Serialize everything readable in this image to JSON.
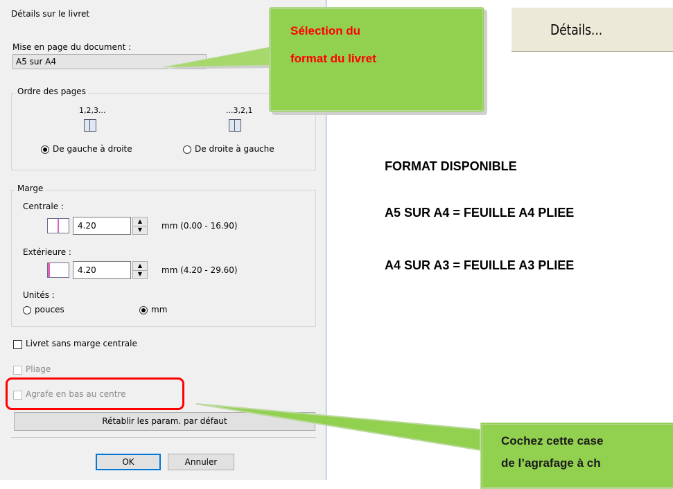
{
  "dialog": {
    "title": "Détails sur le livret",
    "layout_label": "Mise en page du document :",
    "layout_value": "A5 sur A4",
    "page_order": {
      "legend": "Ordre des pages",
      "ltr_icon_label": "1,2,3...",
      "rtl_icon_label": "...3,2,1",
      "ltr_label": "De gauche à droite",
      "rtl_label": "De droite à gauche",
      "selected": "ltr"
    },
    "margin": {
      "legend": "Marge",
      "central_label": "Centrale :",
      "central_value": "4.20",
      "central_range": "mm (0.00 - 16.90)",
      "outer_label": "Extérieure :",
      "outer_value": "4.20",
      "outer_range": "mm (4.20 - 29.60)",
      "units_label": "Unités :",
      "unit_inches": "pouces",
      "unit_mm": "mm",
      "selected_unit": "mm"
    },
    "no_center_margin_label": "Livret sans marge centrale",
    "folding_label": "Pliage",
    "staple_label": "Agrafe en bas au centre",
    "reset_button": "Rétablir les param. par défaut",
    "ok_button": "OK",
    "cancel_button": "Annuler"
  },
  "callout_top": {
    "line1": "Sélection du",
    "line2": "format du livret",
    "fill_color": "#92d050",
    "text_color": "#ff0000"
  },
  "details_button": "Détails...",
  "info": {
    "heading": "FORMAT DISPONIBLE",
    "line1": "A5 SUR A4 = FEUILLE A4 PLIEE",
    "line2": "A4 SUR A3 = FEUILLE A3 PLIEE"
  },
  "callout_bottom": {
    "line1": "Cochez cette case",
    "line2": "de l’agrafage à ch",
    "fill_color": "#92d050"
  },
  "highlight_color": "#ff0000"
}
